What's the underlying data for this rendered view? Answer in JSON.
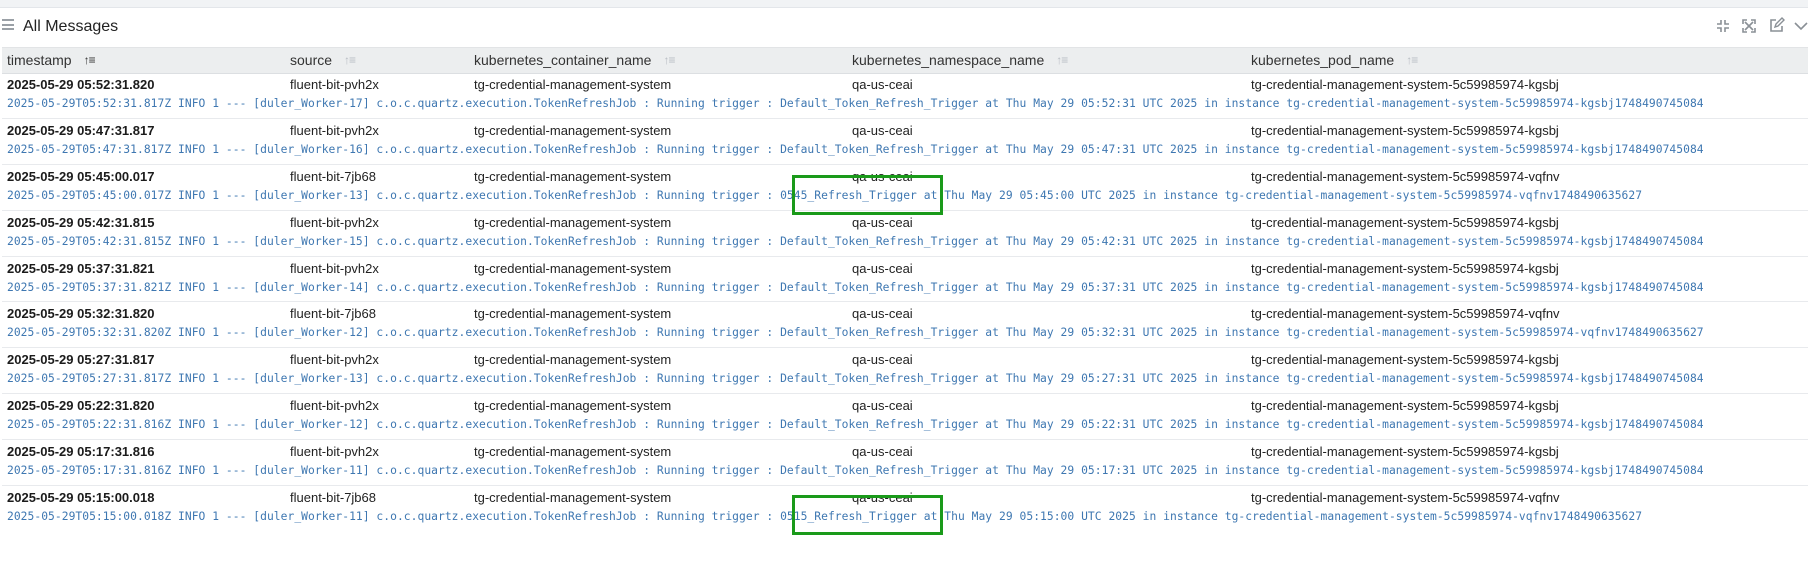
{
  "panel": {
    "title": "All Messages",
    "tools": [
      "collapse-icon",
      "expand-icon",
      "edit-icon",
      "chevron-down-icon"
    ]
  },
  "columns": [
    {
      "label": "timestamp",
      "sort_active": true
    },
    {
      "label": "source",
      "sort_active": false
    },
    {
      "label": "kubernetes_container_name",
      "sort_active": false
    },
    {
      "label": "kubernetes_namespace_name",
      "sort_active": false
    },
    {
      "label": "kubernetes_pod_name",
      "sort_active": false
    }
  ],
  "rows": [
    {
      "timestamp": "2025-05-29 05:52:31.820",
      "source": "fluent-bit-pvh2x",
      "container": "tg-credential-management-system",
      "namespace": "qa-us-ceai",
      "pod": "tg-credential-management-system-5c59985974-kgsbj",
      "message": "2025-05-29T05:52:31.817Z INFO 1 --- [duler_Worker-17] c.o.c.quartz.execution.TokenRefreshJob : Running trigger : Default_Token_Refresh_Trigger at Thu May 29 05:52:31 UTC 2025 in instance tg-credential-management-system-5c59985974-kgsbj1748490745084"
    },
    {
      "timestamp": "2025-05-29 05:47:31.817",
      "source": "fluent-bit-pvh2x",
      "container": "tg-credential-management-system",
      "namespace": "qa-us-ceai",
      "pod": "tg-credential-management-system-5c59985974-kgsbj",
      "message": "2025-05-29T05:47:31.817Z INFO 1 --- [duler_Worker-16] c.o.c.quartz.execution.TokenRefreshJob : Running trigger : Default_Token_Refresh_Trigger at Thu May 29 05:47:31 UTC 2025 in instance tg-credential-management-system-5c59985974-kgsbj1748490745084"
    },
    {
      "timestamp": "2025-05-29 05:45:00.017",
      "source": "fluent-bit-7jb68",
      "container": "tg-credential-management-system",
      "namespace": "qa-us-ceai",
      "pod": "tg-credential-management-system-5c59985974-vqfnv",
      "message": "2025-05-29T05:45:00.017Z INFO 1 --- [duler_Worker-13] c.o.c.quartz.execution.TokenRefreshJob : Running trigger : 0545_Refresh_Trigger at Thu May 29 05:45:00 UTC 2025 in instance tg-credential-management-system-5c59985974-vqfnv1748490635627"
    },
    {
      "timestamp": "2025-05-29 05:42:31.815",
      "source": "fluent-bit-pvh2x",
      "container": "tg-credential-management-system",
      "namespace": "qa-us-ceai",
      "pod": "tg-credential-management-system-5c59985974-kgsbj",
      "message": "2025-05-29T05:42:31.815Z INFO 1 --- [duler_Worker-15] c.o.c.quartz.execution.TokenRefreshJob : Running trigger : Default_Token_Refresh_Trigger at Thu May 29 05:42:31 UTC 2025 in instance tg-credential-management-system-5c59985974-kgsbj1748490745084"
    },
    {
      "timestamp": "2025-05-29 05:37:31.821",
      "source": "fluent-bit-pvh2x",
      "container": "tg-credential-management-system",
      "namespace": "qa-us-ceai",
      "pod": "tg-credential-management-system-5c59985974-kgsbj",
      "message": "2025-05-29T05:37:31.821Z INFO 1 --- [duler_Worker-14] c.o.c.quartz.execution.TokenRefreshJob : Running trigger : Default_Token_Refresh_Trigger at Thu May 29 05:37:31 UTC 2025 in instance tg-credential-management-system-5c59985974-kgsbj1748490745084"
    },
    {
      "timestamp": "2025-05-29 05:32:31.820",
      "source": "fluent-bit-7jb68",
      "container": "tg-credential-management-system",
      "namespace": "qa-us-ceai",
      "pod": "tg-credential-management-system-5c59985974-vqfnv",
      "message": "2025-05-29T05:32:31.820Z INFO 1 --- [duler_Worker-12] c.o.c.quartz.execution.TokenRefreshJob : Running trigger : Default_Token_Refresh_Trigger at Thu May 29 05:32:31 UTC 2025 in instance tg-credential-management-system-5c59985974-vqfnv1748490635627"
    },
    {
      "timestamp": "2025-05-29 05:27:31.817",
      "source": "fluent-bit-pvh2x",
      "container": "tg-credential-management-system",
      "namespace": "qa-us-ceai",
      "pod": "tg-credential-management-system-5c59985974-kgsbj",
      "message": "2025-05-29T05:27:31.817Z INFO 1 --- [duler_Worker-13] c.o.c.quartz.execution.TokenRefreshJob : Running trigger : Default_Token_Refresh_Trigger at Thu May 29 05:27:31 UTC 2025 in instance tg-credential-management-system-5c59985974-kgsbj1748490745084"
    },
    {
      "timestamp": "2025-05-29 05:22:31.820",
      "source": "fluent-bit-pvh2x",
      "container": "tg-credential-management-system",
      "namespace": "qa-us-ceai",
      "pod": "tg-credential-management-system-5c59985974-kgsbj",
      "message": "2025-05-29T05:22:31.816Z INFO 1 --- [duler_Worker-12] c.o.c.quartz.execution.TokenRefreshJob : Running trigger : Default_Token_Refresh_Trigger at Thu May 29 05:22:31 UTC 2025 in instance tg-credential-management-system-5c59985974-kgsbj1748490745084"
    },
    {
      "timestamp": "2025-05-29 05:17:31.816",
      "source": "fluent-bit-pvh2x",
      "container": "tg-credential-management-system",
      "namespace": "qa-us-ceai",
      "pod": "tg-credential-management-system-5c59985974-kgsbj",
      "message": "2025-05-29T05:17:31.816Z INFO 1 --- [duler_Worker-11] c.o.c.quartz.execution.TokenRefreshJob : Running trigger : Default_Token_Refresh_Trigger at Thu May 29 05:17:31 UTC 2025 in instance tg-credential-management-system-5c59985974-kgsbj1748490745084"
    },
    {
      "timestamp": "2025-05-29 05:15:00.018",
      "source": "fluent-bit-7jb68",
      "container": "tg-credential-management-system",
      "namespace": "qa-us-ceai",
      "pod": "tg-credential-management-system-5c59985974-vqfnv",
      "message": "2025-05-29T05:15:00.018Z INFO 1 --- [duler_Worker-11] c.o.c.quartz.execution.TokenRefreshJob : Running trigger : 0515_Refresh_Trigger at Thu May 29 05:15:00 UTC 2025 in instance tg-credential-management-system-5c59985974-vqfnv1748490635627"
    }
  ],
  "annotation_color": "#1a9a1a"
}
